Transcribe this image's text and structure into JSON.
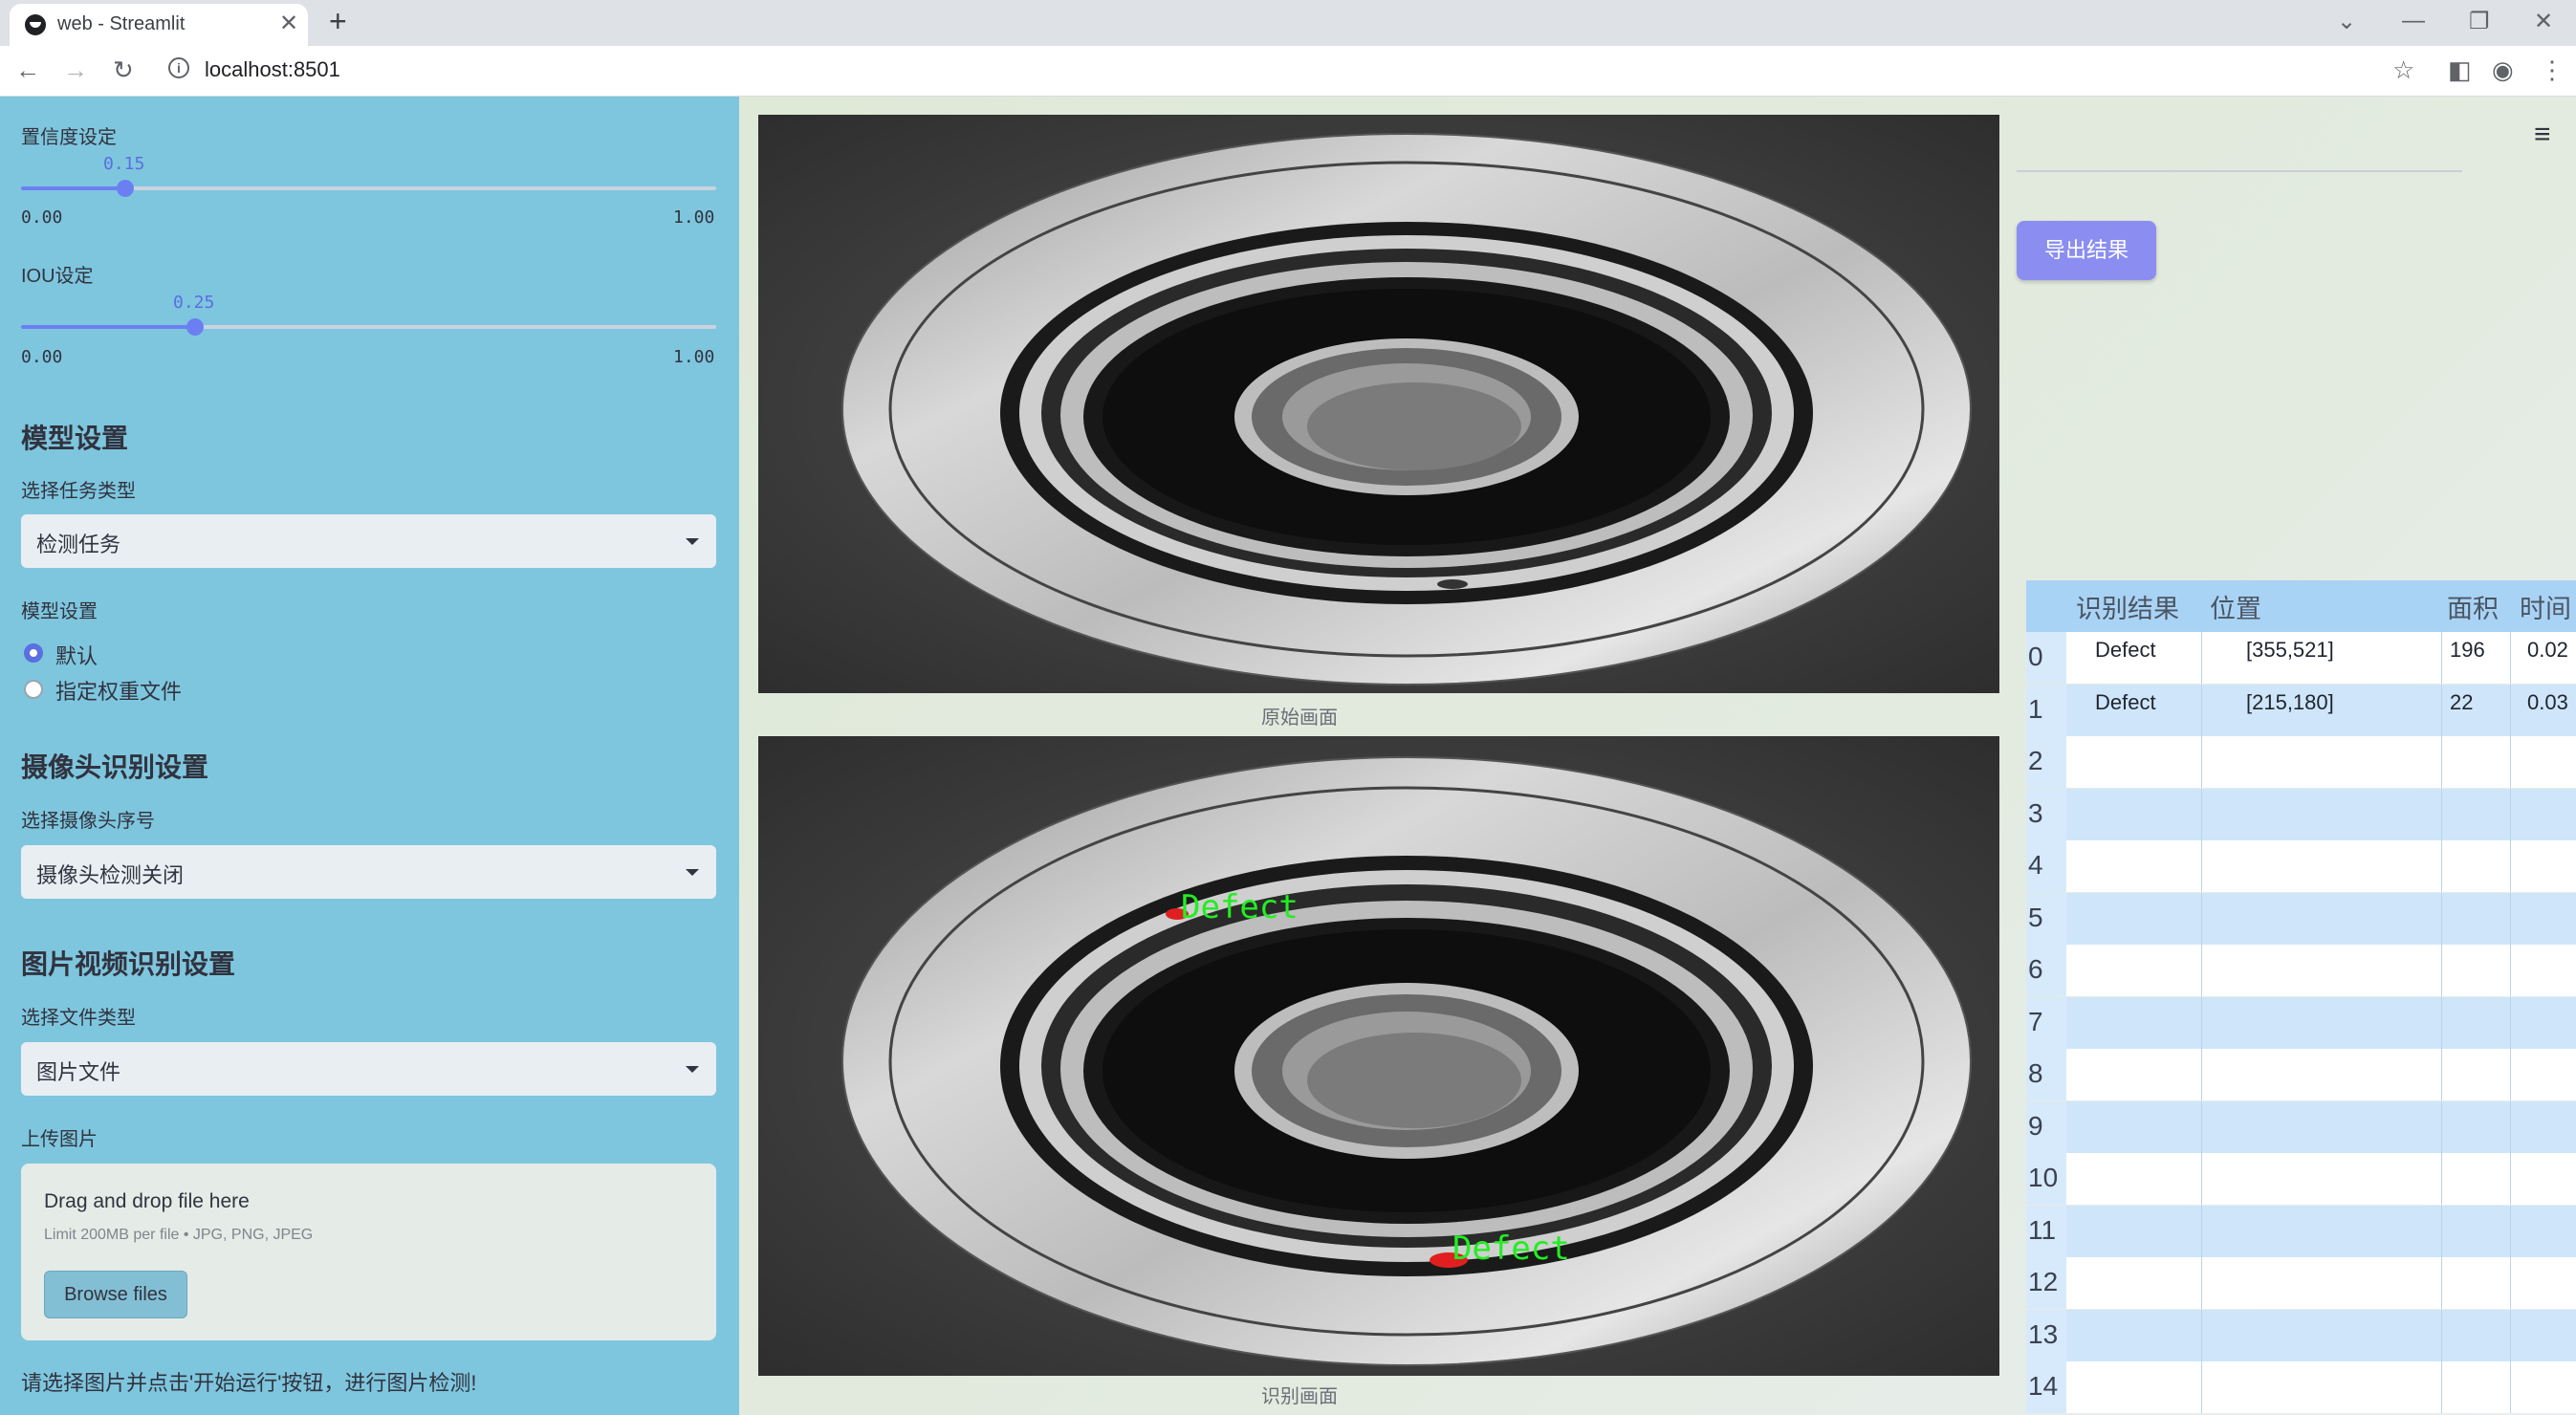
{
  "browser": {
    "tab_title": "web - Streamlit",
    "url": "localhost:8501",
    "tab_close": "✕",
    "new_tab": "+"
  },
  "sidebar": {
    "confidence": {
      "label": "置信度设定",
      "value": 0.15,
      "value_text": "0.15",
      "min_text": "0.00",
      "max_text": "1.00"
    },
    "iou": {
      "label": "IOU设定",
      "value": 0.25,
      "value_text": "0.25",
      "min_text": "0.00",
      "max_text": "1.00"
    },
    "model_header": "模型设置",
    "task_label": "选择任务类型",
    "task_value": "检测任务",
    "model_label": "模型设置",
    "model_options": [
      "默认",
      "指定权重文件"
    ],
    "model_selected": "默认",
    "camera_header": "摄像头识别设置",
    "camera_label": "选择摄像头序号",
    "camera_value": "摄像头检测关闭",
    "media_header": "图片视频识别设置",
    "filetype_label": "选择文件类型",
    "filetype_value": "图片文件",
    "upload_label": "上传图片",
    "upload_drop": "Drag and drop file here",
    "upload_limit": "Limit 200MB per file • JPG, PNG, JPEG",
    "browse_label": "Browse files",
    "hint": "请选择图片并点击'开始运行'按钮，进行图片检测!"
  },
  "main": {
    "original_caption": "原始画面",
    "result_caption": "识别画面",
    "detection_labels": [
      "Defect",
      "Defect"
    ],
    "export_label": "导出结果",
    "colors": {
      "sidebar": "#7ec6de",
      "accent": "#6c7ff2",
      "detect_text": "#22ee22",
      "detect_mark": "#e02020"
    }
  },
  "table": {
    "headers": [
      "识别结果",
      "位置",
      "面积",
      "时间"
    ],
    "rows": [
      {
        "index": "0",
        "result": "Defect",
        "pos": "[355,521]",
        "area": "196",
        "time": "0.02"
      },
      {
        "index": "1",
        "result": "Defect",
        "pos": "[215,180]",
        "area": "22",
        "time": "0.03"
      },
      {
        "index": "2",
        "result": "",
        "pos": "",
        "area": "",
        "time": ""
      },
      {
        "index": "3",
        "result": "",
        "pos": "",
        "area": "",
        "time": ""
      },
      {
        "index": "4",
        "result": "",
        "pos": "",
        "area": "",
        "time": ""
      },
      {
        "index": "5",
        "result": "",
        "pos": "",
        "area": "",
        "time": ""
      },
      {
        "index": "6",
        "result": "",
        "pos": "",
        "area": "",
        "time": ""
      },
      {
        "index": "7",
        "result": "",
        "pos": "",
        "area": "",
        "time": ""
      },
      {
        "index": "8",
        "result": "",
        "pos": "",
        "area": "",
        "time": ""
      },
      {
        "index": "9",
        "result": "",
        "pos": "",
        "area": "",
        "time": ""
      },
      {
        "index": "10",
        "result": "",
        "pos": "",
        "area": "",
        "time": ""
      },
      {
        "index": "11",
        "result": "",
        "pos": "",
        "area": "",
        "time": ""
      },
      {
        "index": "12",
        "result": "",
        "pos": "",
        "area": "",
        "time": ""
      },
      {
        "index": "13",
        "result": "",
        "pos": "",
        "area": "",
        "time": ""
      },
      {
        "index": "14",
        "result": "",
        "pos": "",
        "area": "",
        "time": ""
      }
    ]
  }
}
